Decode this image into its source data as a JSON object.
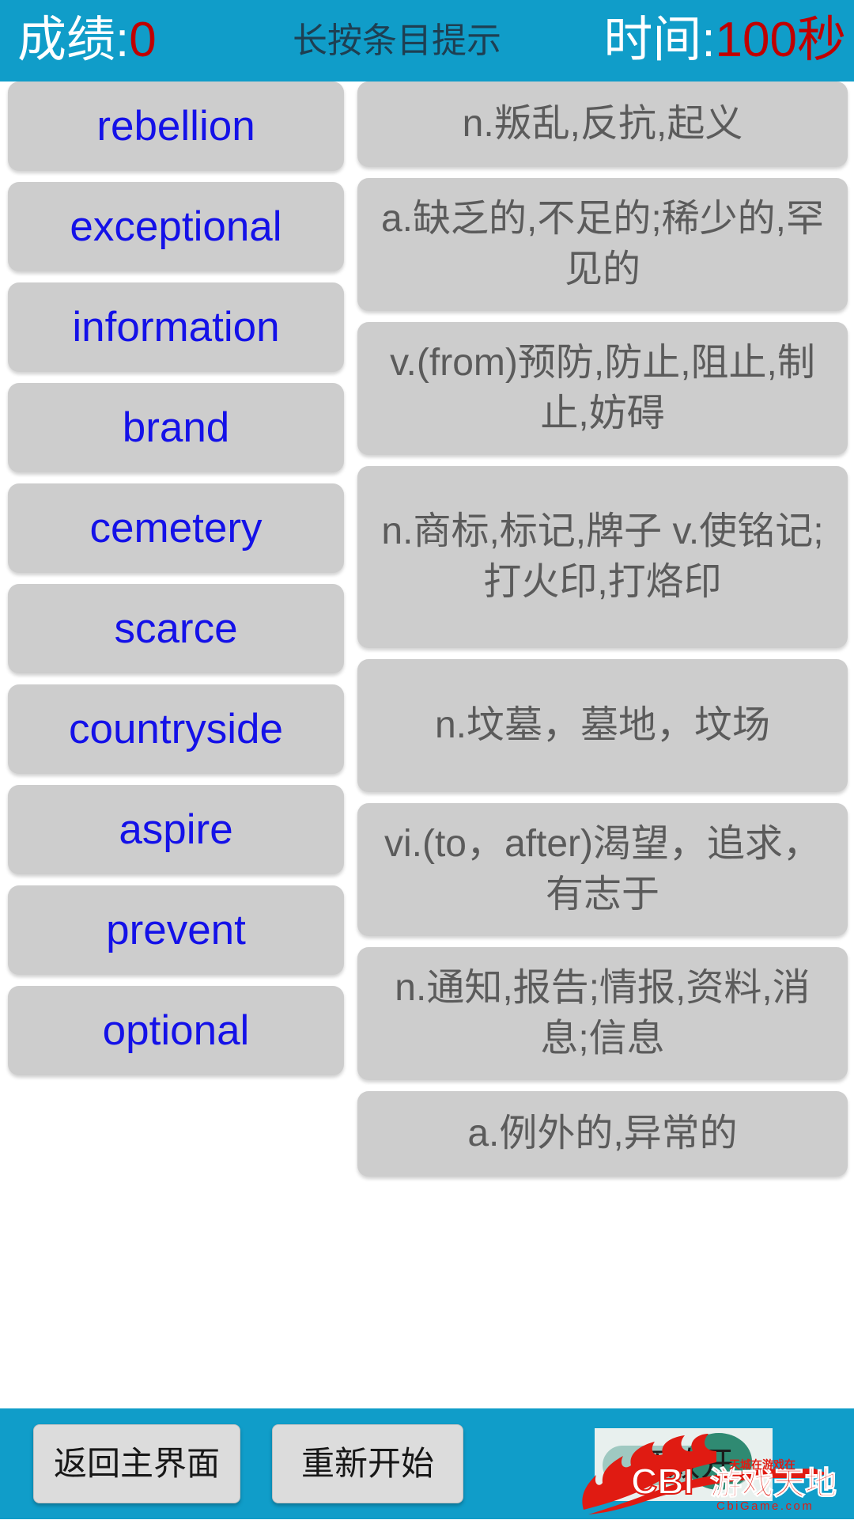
{
  "header": {
    "score_label": "成绩:",
    "score_value": "0",
    "hint_text": "长按条目提示",
    "time_label": "时间:",
    "time_value": "100秒"
  },
  "colors": {
    "bar": "#109dc9",
    "card": "#cdcdcd",
    "word_text": "#1411e8",
    "def_text": "#5b5b5b",
    "accent_red": "#c00000"
  },
  "words": [
    {
      "text": "rebellion"
    },
    {
      "text": "exceptional"
    },
    {
      "text": "information"
    },
    {
      "text": "brand"
    },
    {
      "text": "cemetery"
    },
    {
      "text": "scarce"
    },
    {
      "text": "countryside"
    },
    {
      "text": "aspire"
    },
    {
      "text": "prevent"
    },
    {
      "text": "optional"
    }
  ],
  "definitions": [
    {
      "text": "n.叛乱,反抗,起义",
      "lines": 1
    },
    {
      "text": "a.缺乏的,不足的;稀少的,罕见的",
      "lines": 2
    },
    {
      "text": "v.(from)预防,防止,阻止,制止,妨碍",
      "lines": 2
    },
    {
      "text": "n.商标,标记,牌子 v.使铭记;打火印,打烙印",
      "lines": 3
    },
    {
      "text": "n.坟墓，墓地，坟场",
      "lines": 2
    },
    {
      "text": "vi.(to，after)渴望，追求，有志于",
      "lines": 2
    },
    {
      "text": "n.通知,报告;情报,资料,消息;信息",
      "lines": 2
    },
    {
      "text": "a.例外的,异常的",
      "lines": 1
    }
  ],
  "footer": {
    "home_label": "返回主界面",
    "restart_label": "重新开始",
    "sound_label": "音效开"
  },
  "watermark": {
    "brand": "CBI",
    "brand_cn": "游戏天地",
    "tagline_cn": "天城在游戏在",
    "url": "CbiGame.com"
  }
}
